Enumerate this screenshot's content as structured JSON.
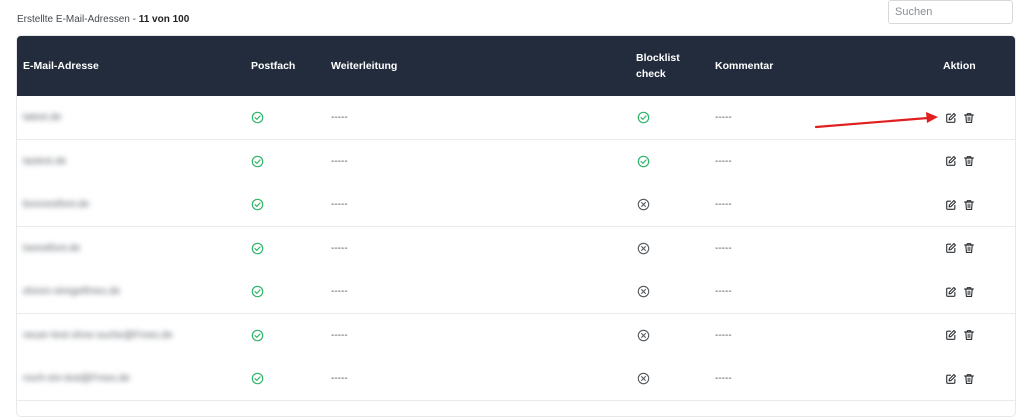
{
  "header": {
    "caption": "Erstellte E-Mail-Adressen - ",
    "count": "11 von 100"
  },
  "search": {
    "placeholder": "Suchen"
  },
  "table": {
    "columns": {
      "email": "E-Mail-Adresse",
      "postfach": "Postfach",
      "weiterleitung": "Weiterleitung",
      "blocklist": "Blocklist check",
      "kommentar": "Kommentar",
      "aktion": "Aktion"
    },
    "rows": [
      {
        "email": "tatest.de",
        "postfach": "check",
        "weiterleitung": "-----",
        "blocklist": "check",
        "kommentar": "-----"
      },
      {
        "email": "tastest.de",
        "postfach": "check",
        "weiterleitung": "-----",
        "blocklist": "check",
        "kommentar": "-----"
      },
      {
        "email": "bonnestfont.de",
        "postfach": "check",
        "weiterleitung": "-----",
        "blocklist": "cross",
        "kommentar": "-----"
      },
      {
        "email": "loeestfont.de",
        "postfach": "check",
        "weiterleitung": "-----",
        "blocklist": "cross",
        "kommentar": "-----"
      },
      {
        "email": "eloren-stregetfmes.de",
        "postfach": "check",
        "weiterleitung": "-----",
        "blocklist": "cross",
        "kommentar": "-----"
      },
      {
        "email": "neuer-test-ohne-suche@Fmes.de",
        "postfach": "check",
        "weiterleitung": "-----",
        "blocklist": "cross",
        "kommentar": "-----"
      },
      {
        "email": "noch-ein-test@Fmes.de",
        "postfach": "check",
        "weiterleitung": "-----",
        "blocklist": "cross",
        "kommentar": "-----"
      }
    ]
  },
  "icons": {
    "check": "check-circle-icon",
    "cross": "x-circle-icon",
    "edit": "edit-icon",
    "delete": "trash-icon"
  },
  "colors": {
    "header_bg": "#222c3c",
    "check": "#2fb56a",
    "cross": "#555b61",
    "annotation": "#e02020"
  }
}
